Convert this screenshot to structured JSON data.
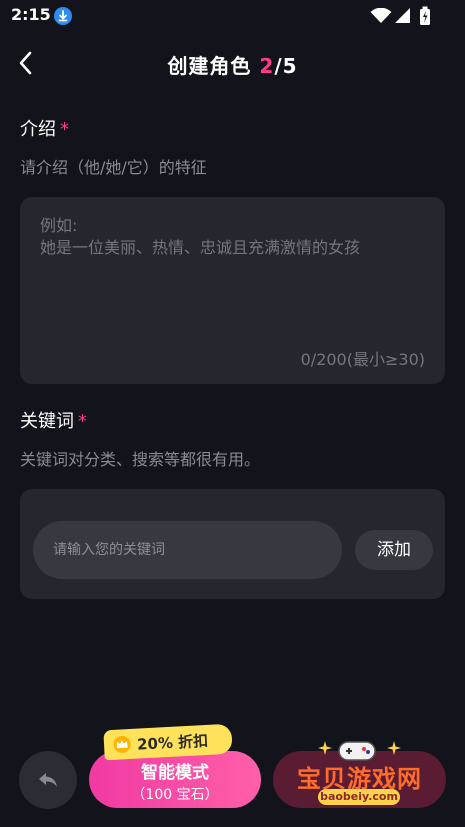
{
  "status_bar": {
    "time": "2:15",
    "icons": [
      "download-icon",
      "wifi-icon",
      "signal-icon",
      "battery-icon"
    ]
  },
  "header": {
    "title": "创建角色",
    "step_current": "2",
    "step_total": "/5",
    "back_icon": "back-arrow-icon"
  },
  "intro": {
    "label": "介绍",
    "required_mark": "*",
    "hint": "请介绍（他/她/它）的特征",
    "placeholder": "例如:\n她是一位美丽、热情、忠诚且充满激情的女孩",
    "counter": "0/200(最小≥30)"
  },
  "keywords": {
    "label": "关键词",
    "required_mark": "*",
    "hint": "关键词对分类、搜索等都很有用。",
    "input_placeholder": "请输入您的关键词",
    "add_label": "添加"
  },
  "footer": {
    "undo_icon": "undo-arrow-icon",
    "discount_label": "20% 折扣",
    "smart_mode_label": "智能模式",
    "smart_mode_cost": "（100 宝石）",
    "watermark_text": "宝贝游戏网",
    "watermark_url": "baobeiy.com"
  },
  "colors": {
    "background": "#13131b",
    "card": "#26262f",
    "accent_pink": "#ff3c8a",
    "badge_yellow": "#ffe25a",
    "hint_gray": "#8a8a94"
  }
}
